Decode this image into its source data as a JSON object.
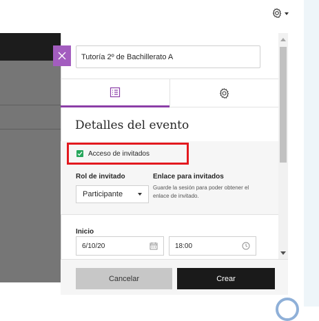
{
  "colors": {
    "accent": "#8b3ea7",
    "close_button": "#a35dbf",
    "checkbox": "#26a65b",
    "highlight_box": "#e3191f",
    "primary_button": "#1a1a1a",
    "secondary_button": "#c7c7c7"
  },
  "top_bar": {
    "settings_icon": "gear-icon",
    "menu_icon": "chevron-down-icon"
  },
  "panel": {
    "close_icon": "close-icon",
    "title_value": "Tutoría 2º de Bachillerato A",
    "tabs": [
      {
        "icon": "list-icon",
        "selected": true
      },
      {
        "icon": "gear-icon",
        "selected": false
      }
    ],
    "section_title": "Detalles del evento",
    "guest_access": {
      "label": "Acceso de invitados",
      "checked": true
    },
    "guest_role": {
      "label": "Rol de invitado",
      "value": "Participante"
    },
    "guest_link": {
      "label": "Enlace para invitados",
      "description": "Guarde la sesión para poder obtener el enlace de invitado."
    },
    "start": {
      "label": "Inicio",
      "date": "6/10/20",
      "time": "18:00",
      "date_icon": "calendar-icon",
      "time_icon": "clock-icon"
    },
    "buttons": {
      "cancel": "Cancelar",
      "create": "Crear"
    }
  }
}
